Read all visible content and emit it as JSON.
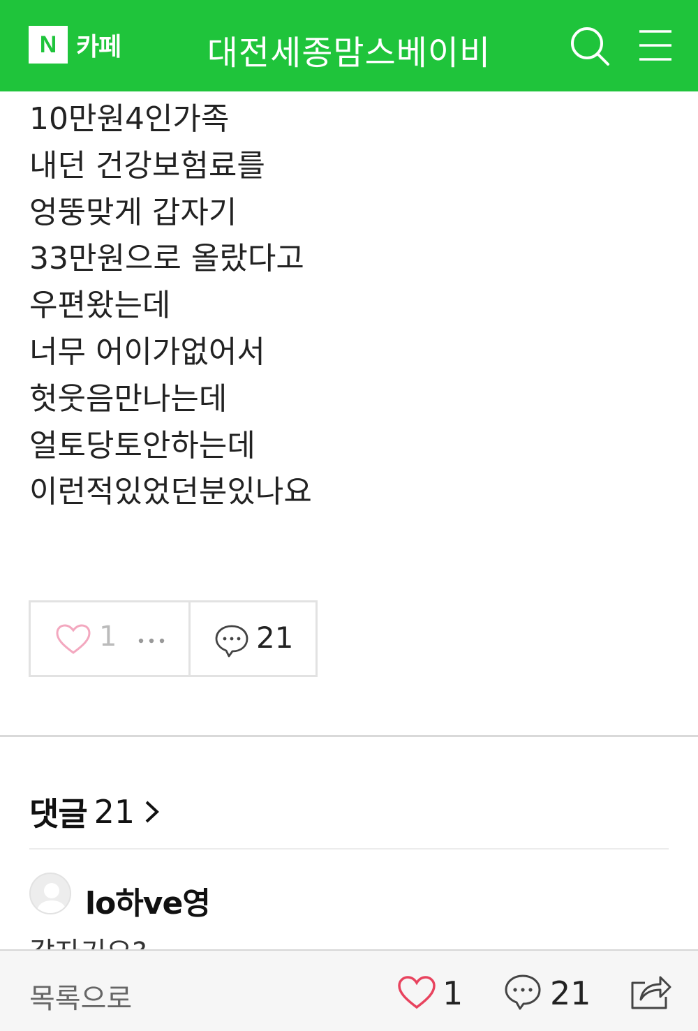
{
  "header": {
    "logo_letter": "N",
    "logo_label": "카페",
    "cafe_name": "대전세종맘스베이비"
  },
  "post": {
    "lines": [
      "10만원4인가족",
      "내던 건강보험료를",
      "엉뚱맞게 갑자기",
      "33만원으로 올랐다고",
      "우편왔는데",
      "너무 어이가없어서",
      "헛웃음만나는데",
      "얼토당토안하는데",
      "이런적있었던분있나요"
    ]
  },
  "reactions": {
    "like_count": "1",
    "comment_count": "21"
  },
  "comments": {
    "label": "댓글",
    "count": "21",
    "items": [
      {
        "author": "lo하ve영",
        "text": "갑자기요?"
      }
    ]
  },
  "bottom_bar": {
    "list_label": "목록으로",
    "like_count": "1",
    "comment_count": "21"
  },
  "colors": {
    "brand_green": "#1fc43b",
    "heart_pink": "#f0a6b8",
    "heart_red": "#e8435e"
  },
  "icons": [
    "search-icon",
    "menu-icon",
    "heart-icon",
    "more-icon",
    "comment-icon",
    "chevron-right-icon",
    "share-icon"
  ]
}
